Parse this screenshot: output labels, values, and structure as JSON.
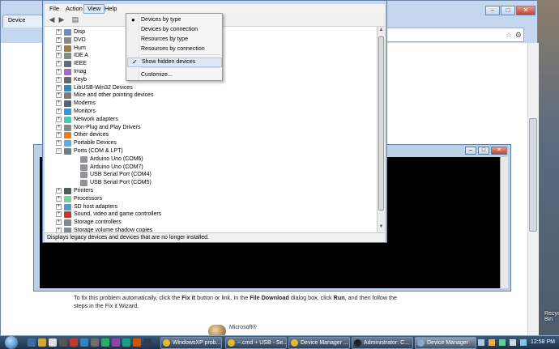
{
  "browser": {
    "tab_title": "Device",
    "fix_it_text_parts": [
      "To fix this problem automatically, click the ",
      "Fix it",
      " button or link. In the ",
      "File Download",
      " dialog box, click ",
      "Run",
      ", and then follow the steps in the Fix it Wizard."
    ],
    "ms_logo_text": "Microsoft®"
  },
  "desktop": {
    "right_label": "Recycle Bin"
  },
  "device_manager": {
    "menu": [
      "File",
      "Action",
      "View",
      "Help"
    ],
    "open_menu_index": 2,
    "view_menu_items": [
      {
        "label": "Devices by type",
        "mark": "●"
      },
      {
        "label": "Devices by connection",
        "mark": ""
      },
      {
        "label": "Resources by type",
        "mark": ""
      },
      {
        "label": "Resources by connection",
        "mark": ""
      },
      {
        "label": "Show hidden devices",
        "mark": "✓"
      },
      {
        "label": "Customize...",
        "mark": ""
      }
    ],
    "tree": [
      {
        "label": "Disp",
        "level": 0,
        "expander": "+",
        "icon": "display-icon"
      },
      {
        "label": "DVD",
        "level": 0,
        "expander": "+",
        "icon": "dvd-icon"
      },
      {
        "label": "Hum",
        "level": 0,
        "expander": "+",
        "icon": "hid-icon"
      },
      {
        "label": "IDE A",
        "level": 0,
        "expander": "+",
        "icon": "ide-icon"
      },
      {
        "label": "IEEE",
        "level": 0,
        "expander": "+",
        "icon": "ieee-icon"
      },
      {
        "label": "Imag",
        "level": 0,
        "expander": "+",
        "icon": "imaging-icon"
      },
      {
        "label": "Keyb",
        "level": 0,
        "expander": "+",
        "icon": "keyboard-icon"
      },
      {
        "label": "LibUSB-Win32 Devices",
        "level": 0,
        "expander": "+",
        "icon": "usb-icon"
      },
      {
        "label": "Mice and other pointing devices",
        "level": 0,
        "expander": "+",
        "icon": "mouse-icon"
      },
      {
        "label": "Modems",
        "level": 0,
        "expander": "+",
        "icon": "modem-icon"
      },
      {
        "label": "Monitors",
        "level": 0,
        "expander": "+",
        "icon": "monitor-icon"
      },
      {
        "label": "Network adapters",
        "level": 0,
        "expander": "+",
        "icon": "network-icon"
      },
      {
        "label": "Non-Plug and Play Drivers",
        "level": 0,
        "expander": "+",
        "icon": "driver-icon"
      },
      {
        "label": "Other devices",
        "level": 0,
        "expander": "+",
        "icon": "other-device-icon"
      },
      {
        "label": "Portable Devices",
        "level": 0,
        "expander": "+",
        "icon": "portable-icon"
      },
      {
        "label": "Ports (COM & LPT)",
        "level": 0,
        "expander": "−",
        "icon": "port-icon"
      },
      {
        "label": "Arduino Uno (COM6)",
        "level": 1,
        "expander": "",
        "icon": "port-icon"
      },
      {
        "label": "Arduino Uno (COM7)",
        "level": 1,
        "expander": "",
        "icon": "port-icon"
      },
      {
        "label": "USB Serial Port (COM4)",
        "level": 1,
        "expander": "",
        "icon": "port-icon"
      },
      {
        "label": "USB Serial Port (COM5)",
        "level": 1,
        "expander": "",
        "icon": "port-icon"
      },
      {
        "label": "Printers",
        "level": 0,
        "expander": "+",
        "icon": "printer-icon"
      },
      {
        "label": "Processors",
        "level": 0,
        "expander": "+",
        "icon": "processor-icon"
      },
      {
        "label": "SD host adapters",
        "level": 0,
        "expander": "+",
        "icon": "sd-icon"
      },
      {
        "label": "Sound, video and game controllers",
        "level": 0,
        "expander": "+",
        "icon": "sound-icon"
      },
      {
        "label": "Storage controllers",
        "level": 0,
        "expander": "+",
        "icon": "storage-icon"
      },
      {
        "label": "Storage volume shadow copies",
        "level": 0,
        "expander": "+",
        "icon": "storage-icon"
      }
    ],
    "status_text": "Displays legacy devices and devices that are no longer installed."
  },
  "taskbar": {
    "buttons": [
      {
        "label": "WindowsXP prob...",
        "icon": "chrome-icon",
        "active": false
      },
      {
        "label": "~.cmd + USB - Se...",
        "icon": "chrome-icon",
        "active": false
      },
      {
        "label": "Device Manager ...",
        "icon": "chrome-icon",
        "active": false
      },
      {
        "label": "Administrator: C...",
        "icon": "cmd-icon",
        "active": false
      },
      {
        "label": "Device Manager",
        "icon": "device-manager-icon",
        "active": true
      }
    ],
    "clock": "12:58 PM"
  },
  "colors": {
    "cmd_background": "#000000",
    "menu_highlight": "#dde8f6",
    "window_frame": "#c3d6ec"
  }
}
